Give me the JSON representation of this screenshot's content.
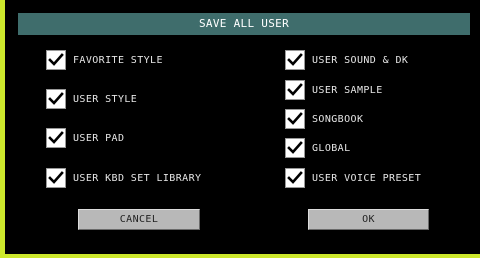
{
  "dialog": {
    "title": "SAVE ALL USER"
  },
  "options_left": [
    {
      "label": "FAVORITE STYLE",
      "checked": true
    },
    {
      "label": "USER STYLE",
      "checked": true
    },
    {
      "label": "USER PAD",
      "checked": true
    },
    {
      "label": "USER KBD SET LIBRARY",
      "checked": true
    }
  ],
  "options_right": [
    {
      "label": "USER SOUND & DK",
      "checked": true
    },
    {
      "label": "USER SAMPLE",
      "checked": true
    },
    {
      "label": "SONGBOOK",
      "checked": true
    },
    {
      "label": "GLOBAL",
      "checked": true
    },
    {
      "label": "USER VOICE PRESET",
      "checked": true
    }
  ],
  "buttons": {
    "cancel": "CANCEL",
    "ok": "OK"
  },
  "colors": {
    "frame_accent": "#cde82c",
    "title_bar": "#3f6d6c",
    "background": "#000000",
    "checkbox": "#ffffff",
    "button": "#b8b8b8"
  }
}
